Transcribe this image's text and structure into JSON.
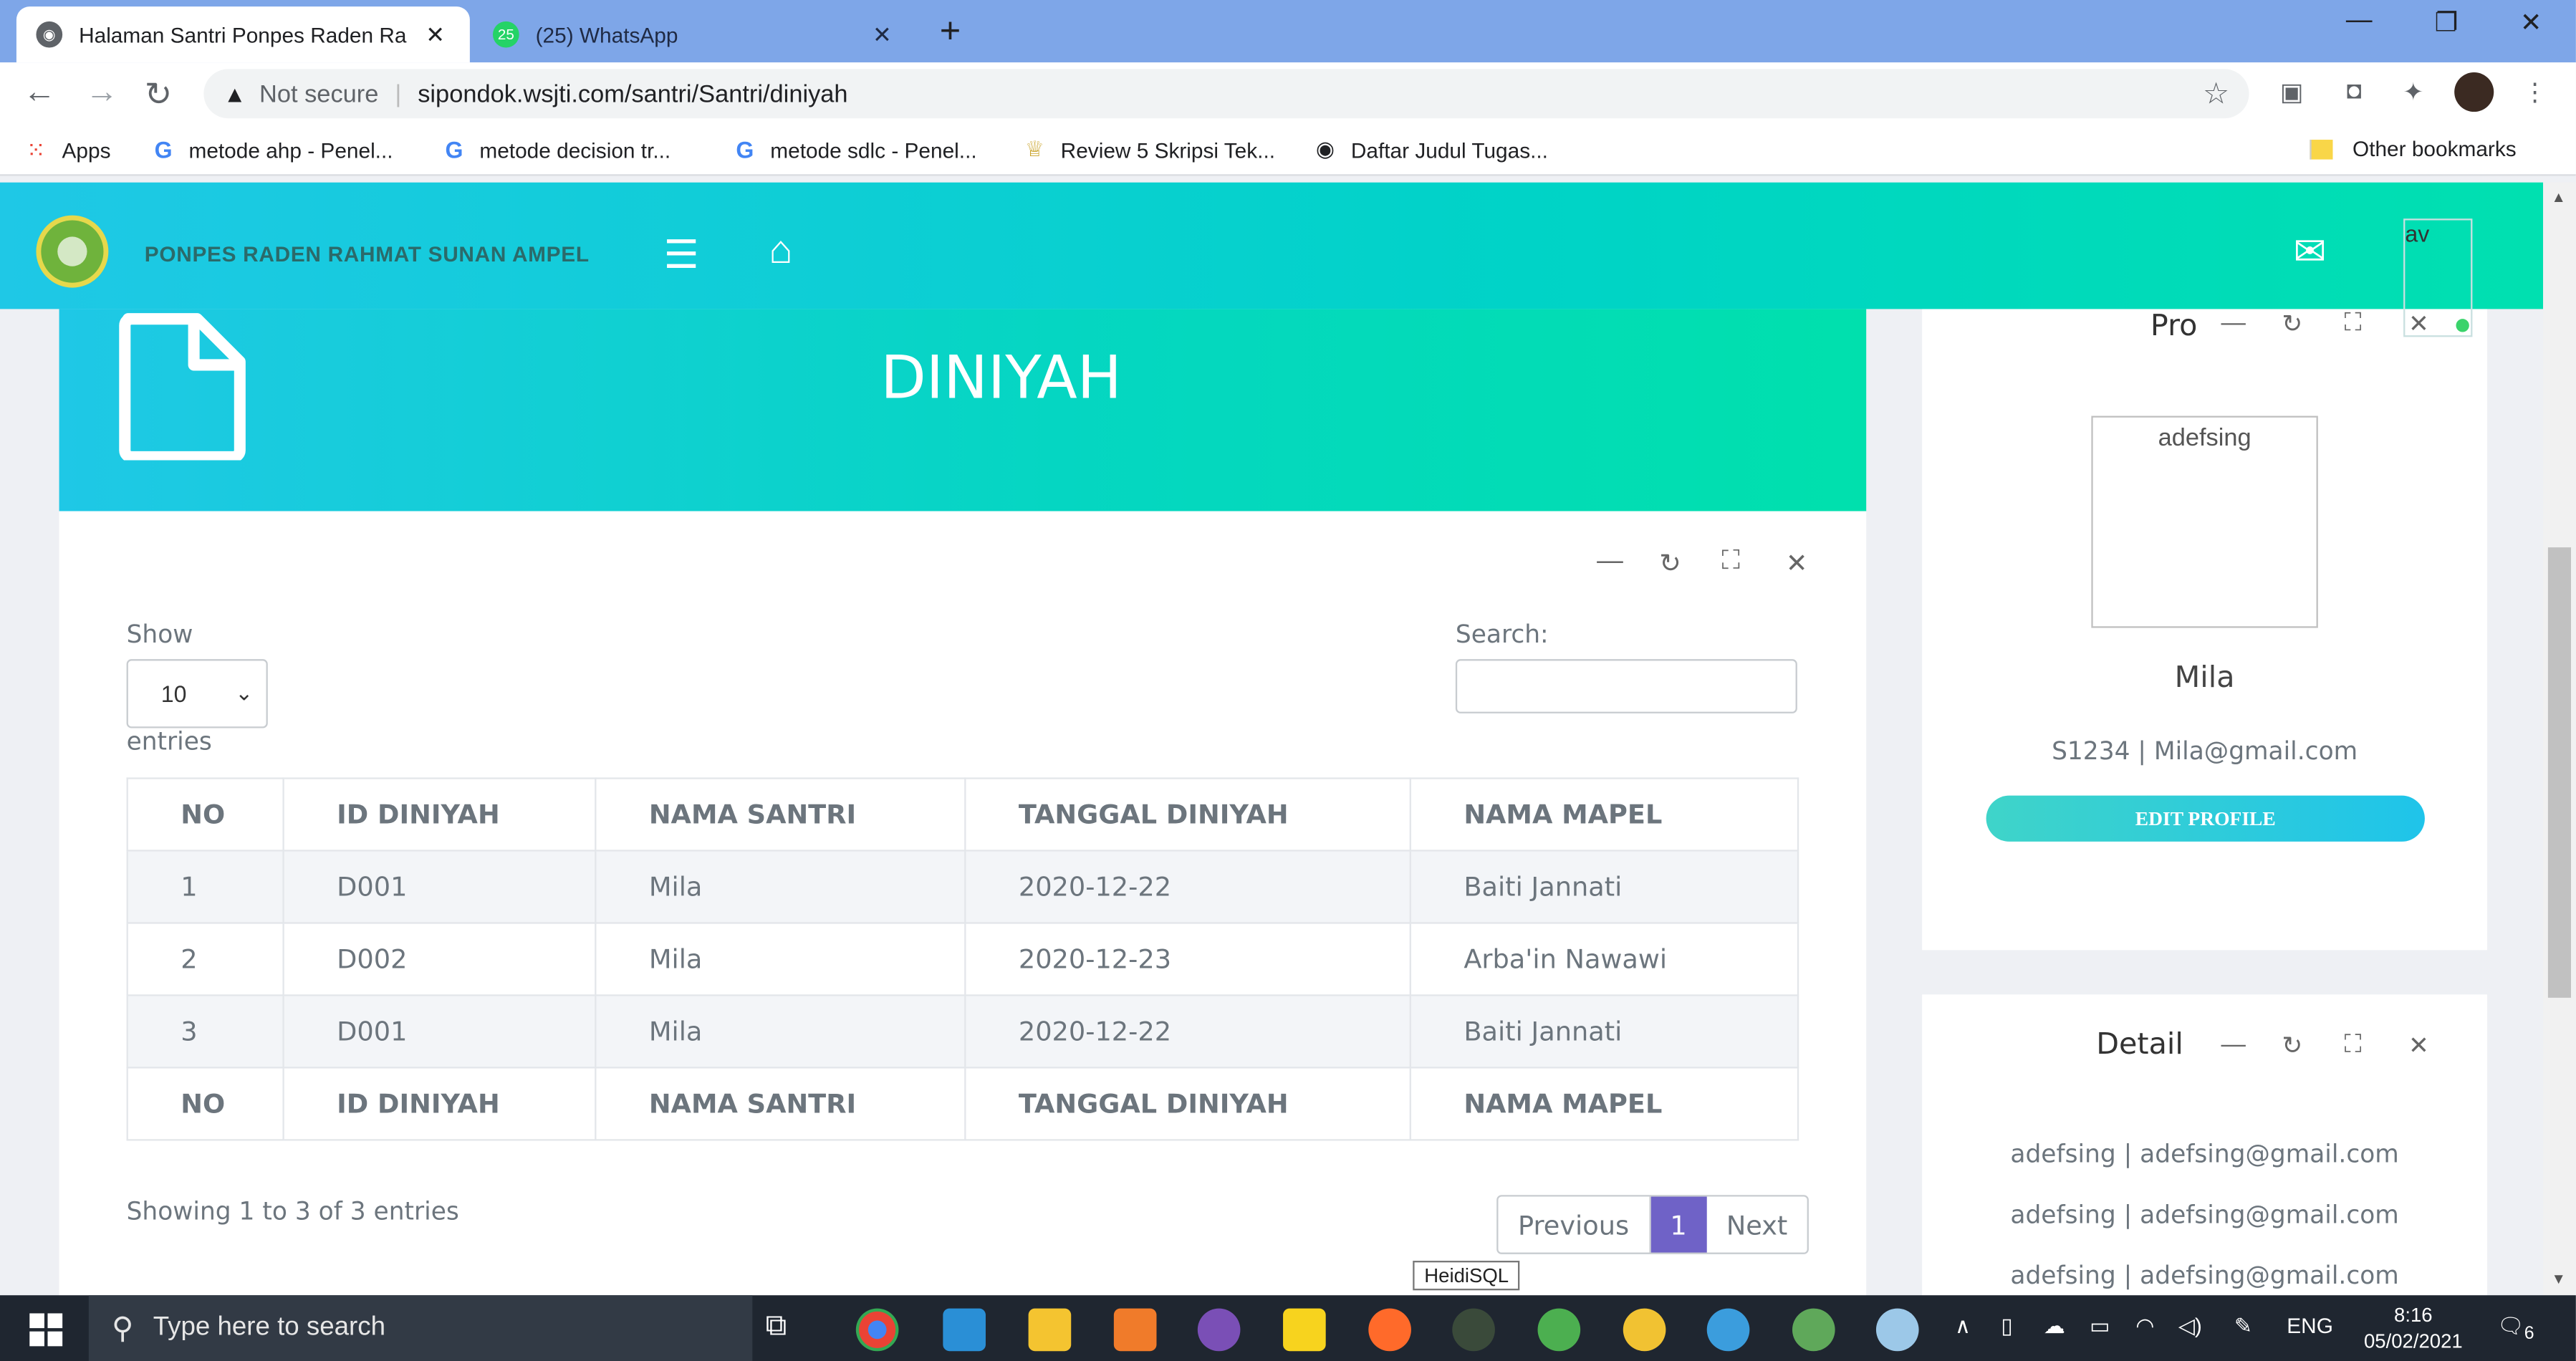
{
  "browser": {
    "tabs": [
      {
        "title": "Halaman Santri Ponpes Raden Ra",
        "close": "✕"
      },
      {
        "title": "(25) WhatsApp",
        "badge": "25",
        "close": "✕"
      }
    ],
    "new_tab": "+",
    "window_controls": {
      "minimize": "—",
      "restore": "❐",
      "close": "✕"
    },
    "address": {
      "security": "Not secure",
      "url": "sipondok.wsjti.com/santri/Santri/diniyah"
    },
    "bookmarks": [
      {
        "label": "Apps",
        "icon": "apps-grid-icon"
      },
      {
        "label": "metode ahp - Penel...",
        "icon": "google-icon"
      },
      {
        "label": "metode decision tr...",
        "icon": "google-icon"
      },
      {
        "label": "metode sdlc - Penel...",
        "icon": "google-icon"
      },
      {
        "label": "Review 5 Skripsi Tek...",
        "icon": "medal-icon"
      },
      {
        "label": "Daftar Judul Tugas...",
        "icon": "globe-icon"
      }
    ],
    "other_bookmarks": "Other bookmarks"
  },
  "header": {
    "brand": "PONPES RADEN RAHMAT SUNAN AMPEL",
    "avatar_alt": "av"
  },
  "banner": {
    "title": "DINIYAH"
  },
  "table_card": {
    "show_label": "Show",
    "entries_value": "10",
    "entries_label": "entries",
    "search_label": "Search:",
    "columns": [
      "NO",
      "ID DINIYAH",
      "NAMA SANTRI",
      "TANGGAL DINIYAH",
      "NAMA MAPEL"
    ],
    "rows": [
      [
        "1",
        "D001",
        "Mila",
        "2020-12-22",
        "Baiti Jannati"
      ],
      [
        "2",
        "D002",
        "Mila",
        "2020-12-23",
        "Arba'in Nawawi"
      ],
      [
        "3",
        "D001",
        "Mila",
        "2020-12-22",
        "Baiti Jannati"
      ]
    ],
    "info": "Showing 1 to 3 of 3 entries",
    "pagination": {
      "previous": "Previous",
      "current": "1",
      "next": "Next"
    }
  },
  "profile_card": {
    "title": "Pro",
    "image_alt": "adefsing",
    "name": "Mila",
    "meta": "S1234 | Mila@gmail.com",
    "edit_button": "EDIT PROFILE"
  },
  "detail_card": {
    "title": "Detail",
    "rows": [
      "adefsing | adefsing@gmail.com",
      "adefsing | adefsing@gmail.com",
      "adefsing | adefsing@gmail.com"
    ]
  },
  "tooltip": "HeidiSQL",
  "taskbar": {
    "search_placeholder": "Type here to search",
    "language": "ENG",
    "time": "8:16",
    "date": "05/02/2021",
    "notifications": "6"
  },
  "colors": {
    "header_gradient_start": "#1fc8e6",
    "header_gradient_end": "#00e0b0",
    "pagination_active": "#6f62c7",
    "taskbar": "#1f2630"
  }
}
